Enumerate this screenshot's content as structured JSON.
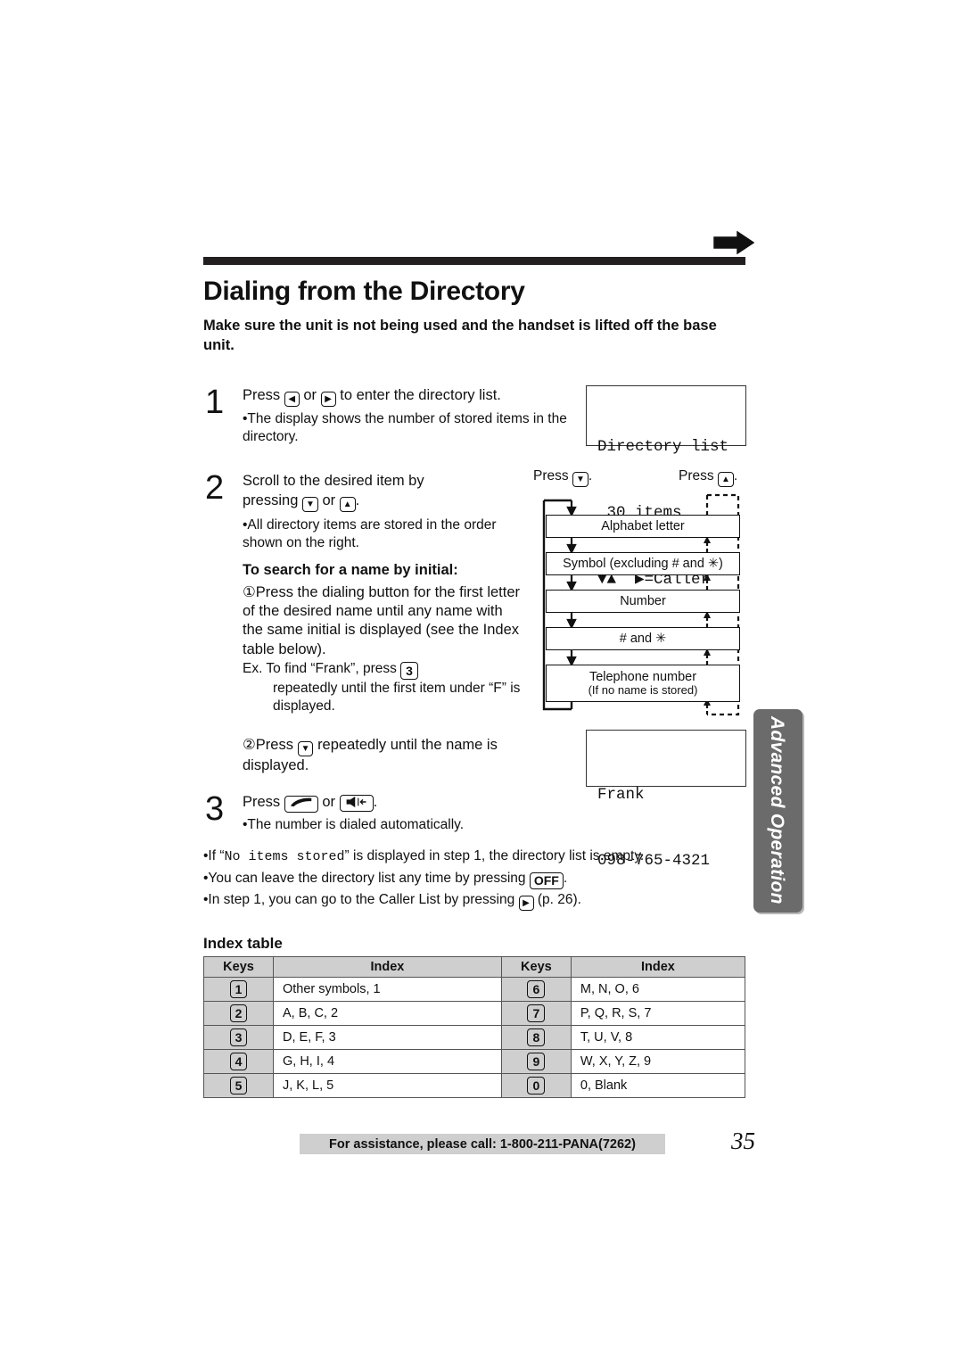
{
  "header": {
    "arrow_icon": "right-arrow-icon",
    "chapter_title": "Dialing from the Directory",
    "intro": "Make sure the unit is not being used and the handset is lifted off the base unit."
  },
  "steps": [
    {
      "number": "1",
      "line_pre": "Press",
      "key_a": "◀",
      "line_mid": "or",
      "key_b": "▶",
      "line_post": "to enter the directory list.",
      "bullet": "•The display shows the number of stored items in the directory."
    },
    {
      "number": "2",
      "line_pre": "Scroll to the desired item by",
      "line2_pre": "pressing",
      "key_a": "▼",
      "line2_mid": "or",
      "key_b": "▲",
      "line2_post": ".",
      "bullet": "•All directory items are stored in the order shown on the right.",
      "sub_heading": "To search for a name by initial:",
      "sub1_pre": "①Press the dialing button for the first letter of the desired name until any name with the same initial is displayed (see the Index table below).",
      "ex_pre": "Ex.  To find “Frank”, press",
      "ex_key": "3",
      "ex_post": "repeatedly until the first item under “F” is displayed.",
      "sub2_pre": "②Press",
      "sub2_key": "▼",
      "sub2_post": "repeatedly until the name is displayed."
    },
    {
      "number": "3",
      "line_pre": "Press",
      "key_a": "handset-phone-icon",
      "line_mid": "or",
      "key_b": "speakerphone-icon",
      "line_post": ".",
      "bullet": "•The number is dialed automatically."
    }
  ],
  "lcd_displays": [
    {
      "name": "directory-list-display",
      "line1": "Directory list",
      "line2": " 30 items",
      "line3": "▼▲  ▶=Caller"
    },
    {
      "name": "frank-display",
      "line1": "Frank",
      "line2": "098-765-4321"
    }
  ],
  "flowchart": {
    "label_down": "Press",
    "label_down_key": "▼",
    "label_down_post": ".",
    "label_up": "Press",
    "label_up_key": "▲",
    "label_up_post": ".",
    "boxes": [
      {
        "text": "Alphabet letter",
        "sub": ""
      },
      {
        "text": "Symbol (excluding # and ✳)",
        "sub": ""
      },
      {
        "text": "Number",
        "sub": ""
      },
      {
        "text": "# and ✳",
        "sub": ""
      },
      {
        "text": "Telephone number",
        "sub": "(If no name is stored)"
      }
    ]
  },
  "notes": [
    {
      "pre": "•If “",
      "mono": "No items stored",
      "post": "” is displayed in step 1, the directory list is empty."
    },
    {
      "pre": "•You can leave the directory list any time by pressing",
      "key": "OFF",
      "post": "."
    },
    {
      "pre": "•In step 1, you can go to the Caller List by pressing",
      "key": "▶",
      "post": "(p. 26)."
    }
  ],
  "side_tab": {
    "label": "Advanced Operation",
    "color": "#6b6b6b"
  },
  "index_table": {
    "title": "Index table",
    "headers": [
      "Keys",
      "Index",
      "Keys",
      "Index"
    ],
    "rows": [
      {
        "key_left": "1",
        "index_left": "Other symbols, 1",
        "key_right": "6",
        "index_right": "M, N, O, 6"
      },
      {
        "key_left": "2",
        "index_left": "A, B, C, 2",
        "key_right": "7",
        "index_right": "P, Q, R, S, 7"
      },
      {
        "key_left": "3",
        "index_left": "D, E, F, 3",
        "key_right": "8",
        "index_right": "T, U, V, 8"
      },
      {
        "key_left": "4",
        "index_left": "G, H, I, 4",
        "key_right": "9",
        "index_right": "W, X, Y, Z, 9"
      },
      {
        "key_left": "5",
        "index_left": "J, K, L, 5",
        "key_right": "0",
        "index_right": "0, Blank"
      }
    ]
  },
  "footer": {
    "assistance": "For assistance, please call: 1-800-211-PANA(7262)",
    "page_number": "35"
  }
}
